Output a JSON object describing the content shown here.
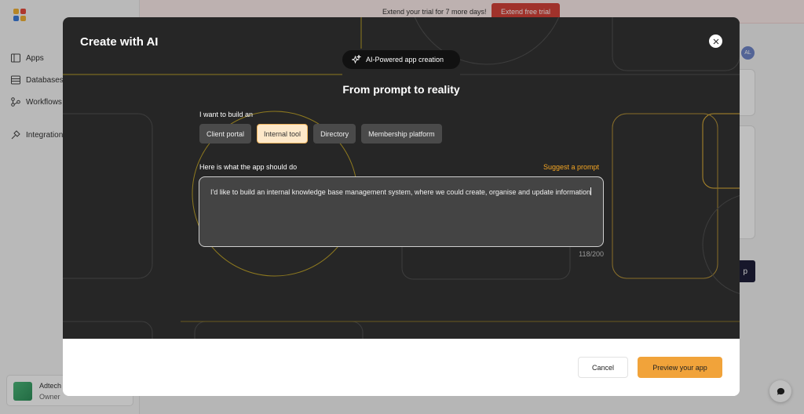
{
  "sidebar": {
    "items": [
      {
        "label": "Apps",
        "icon": "apps-icon"
      },
      {
        "label": "Databases",
        "icon": "database-icon"
      },
      {
        "label": "Workflows",
        "icon": "workflow-icon"
      },
      {
        "label": "Integration",
        "icon": "integration-icon"
      }
    ],
    "org": {
      "name": "Adtech",
      "role": "Owner"
    }
  },
  "banner": {
    "text": "Extend your trial for 7 more days!",
    "button_label": "Extend free trial"
  },
  "header": {
    "avatar_initials": "AL"
  },
  "background": {
    "dark_button_fragment": "p"
  },
  "modal": {
    "title": "Create with AI",
    "badge": "AI-Powered app creation",
    "heading": "From prompt to reality",
    "build_label": "I want to build an",
    "options": [
      {
        "label": "Client portal",
        "selected": false
      },
      {
        "label": "Internal tool",
        "selected": true
      },
      {
        "label": "Directory",
        "selected": false
      },
      {
        "label": "Membership platform",
        "selected": false
      }
    ],
    "description_label": "Here is what the app should do",
    "suggest_label": "Suggest a prompt",
    "prompt_text": "I'd like to build an internal knowledge base management system, where we could create, organise and update information",
    "char_count": "118/200",
    "cancel_label": "Cancel",
    "preview_label": "Preview your app"
  },
  "colors": {
    "accent": "#f1a33a",
    "danger": "#d6433a",
    "hero_bg": "#262626",
    "selected_chip_bg": "#fde8c9"
  }
}
